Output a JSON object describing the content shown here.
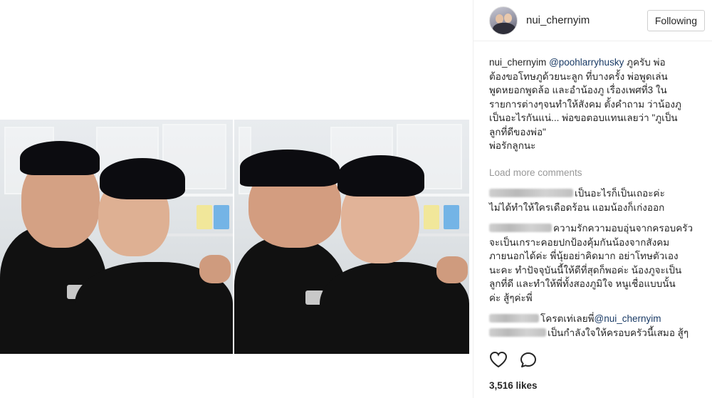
{
  "header": {
    "username": "nui_chernyim",
    "follow_label": "Following"
  },
  "caption": {
    "username": "nui_chernyim",
    "mention": "@poohlarryhusky",
    "lines": [
      " ภูครับ พ่อ",
      "ต้องขอโทษภูด้วยนะลูก ที่บางครั้ง พ่อพูดเล่น",
      "พูดหยอกพูดล้อ และอำน้องภู เรื่องเพศที่3 ใน",
      "รายการต่างๆจนทำให้สังคม ตั้งคำถาม ว่าน้องภู",
      "เป็นอะไรกันแน่... พ่อขอตอบแทนเลยว่า \"ภูเป็น",
      "ลูกที่ดีของพ่อ\"",
      "พ่อรักลูกนะ"
    ]
  },
  "load_more": "Load more comments",
  "comments": [
    {
      "lines": [
        "เป็นอะไรก็เป็นเถอะค่ะ",
        "ไม่ได้ทำให้ใครเดือดร้อน แอมน้องก็เก่งออก"
      ]
    },
    {
      "lines": [
        "ความรักความอบอุ่นจากครอบครัว",
        "จะเป็นเกราะคอยปกป้องคุ้มกันน้องจากสังคม",
        "ภายนอกได้ค่ะ พี่นุ้ยอย่าคิดมาก อย่าโทษตัวเอง",
        "นะคะ ทำปัจจุบันนี้ให้ดีที่สุดก็พอค่ะ น้องภูจะเป็น",
        "ลูกที่ดี และทำให้พี่ทั้งสองภูมิใจ หนูเชื่อแบบนั้น",
        "ค่ะ สู้ๆค่ะพี่"
      ]
    },
    {
      "lines": [
        "โครตเท่เลยพี่"
      ],
      "mention": "@nui_chernyim"
    },
    {
      "lines": [
        "เป็นกำลังใจให้ครอบครัวนี้เสมอ สู้ๆ"
      ]
    }
  ],
  "actions": {
    "like_icon": "heart-icon",
    "comment_icon": "comment-icon"
  },
  "likes": "3,516 likes"
}
